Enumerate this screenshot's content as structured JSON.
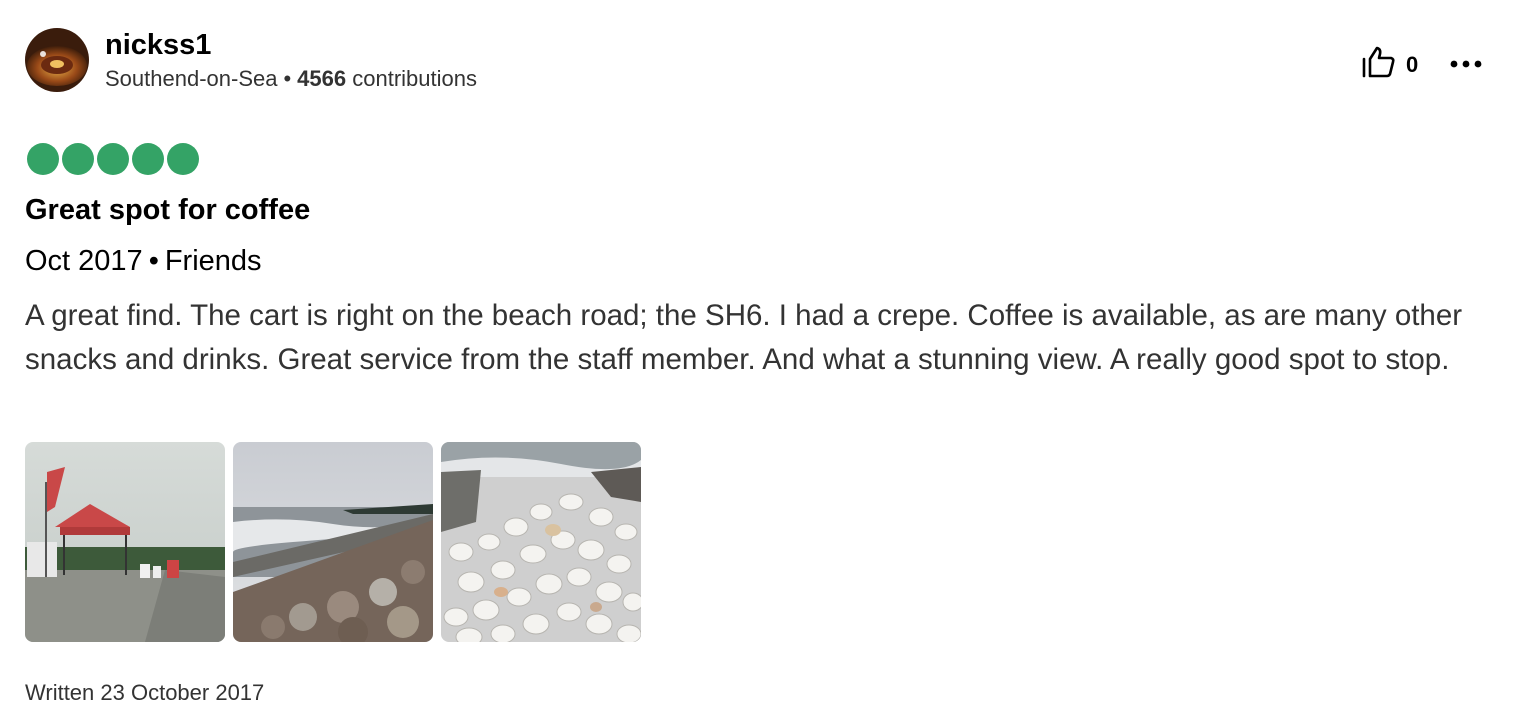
{
  "user": {
    "name": "nickss1",
    "location": "Southend-on-Sea",
    "separator": "•",
    "contributions_count": "4566",
    "contributions_label": "contributions"
  },
  "actions": {
    "helpful_count": "0",
    "helpful_icon": "thumbs-up-icon",
    "more_icon": "more-horizontal-icon"
  },
  "rating": {
    "value": 5,
    "max": 5,
    "color": "#34a366"
  },
  "review": {
    "title": "Great spot for coffee",
    "date": "Oct 2017",
    "separator": "•",
    "trip_type": "Friends",
    "text": "A great find. The cart is right on the beach road; the SH6. I had a crepe. Coffee is available, as are many other snacks and drinks. Great service from the staff member. And what a stunning view. A really good spot to stop.",
    "written": "Written 23 October 2017"
  }
}
